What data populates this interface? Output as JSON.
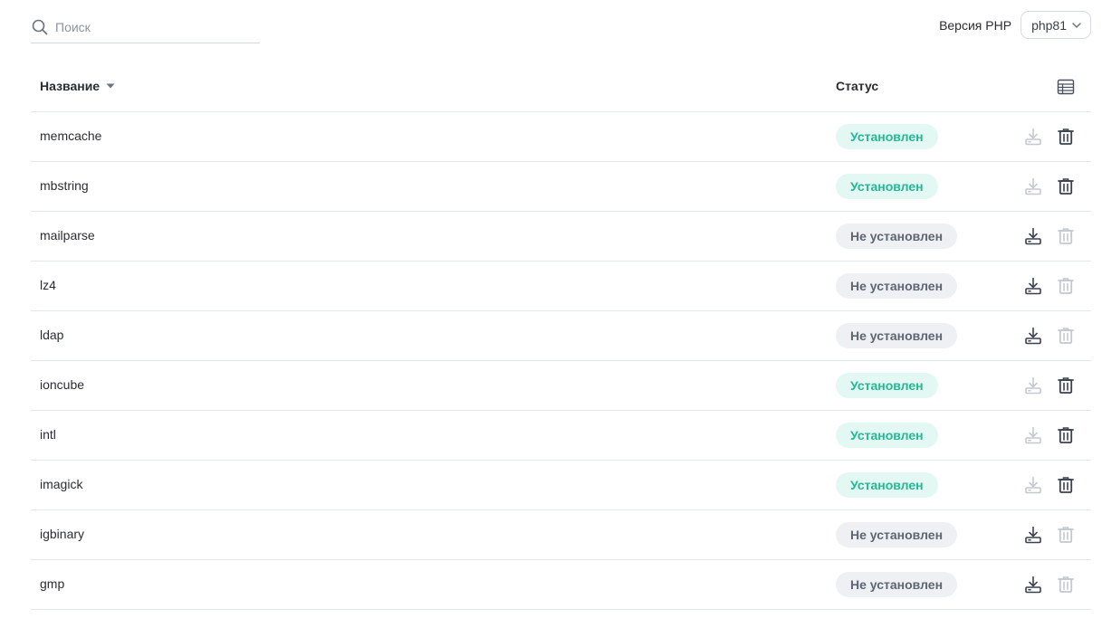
{
  "search": {
    "placeholder": "Поиск",
    "value": ""
  },
  "php": {
    "label": "Версия PHP",
    "selected": "php81"
  },
  "table": {
    "columns": {
      "name": "Название",
      "status": "Статус"
    },
    "rows": [
      {
        "name": "memcache",
        "status": "Установлен",
        "installed": true
      },
      {
        "name": "mbstring",
        "status": "Установлен",
        "installed": true
      },
      {
        "name": "mailparse",
        "status": "Не установлен",
        "installed": false
      },
      {
        "name": "lz4",
        "status": "Не установлен",
        "installed": false
      },
      {
        "name": "ldap",
        "status": "Не установлен",
        "installed": false
      },
      {
        "name": "ioncube",
        "status": "Установлен",
        "installed": true
      },
      {
        "name": "intl",
        "status": "Установлен",
        "installed": true
      },
      {
        "name": "imagick",
        "status": "Установлен",
        "installed": true
      },
      {
        "name": "igbinary",
        "status": "Не установлен",
        "installed": false
      },
      {
        "name": "gmp",
        "status": "Не установлен",
        "installed": false
      }
    ]
  },
  "colors": {
    "installed_text": "#25b896",
    "installed_bg": "#e3f8f2",
    "not_installed_text": "#5e6573",
    "not_installed_bg": "#eef0f4",
    "icon_active": "#3a4150",
    "icon_disabled": "#c4c8d0"
  },
  "icons": {
    "search": "search-icon",
    "chevron": "chevron-down-icon",
    "sort": "sort-desc-icon",
    "columns": "table-columns-icon",
    "install": "install-icon",
    "delete": "trash-icon"
  }
}
